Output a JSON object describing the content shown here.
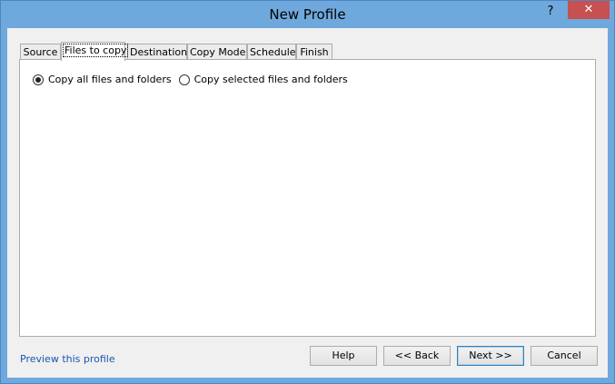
{
  "window": {
    "title": "New Profile",
    "help_glyph": "?",
    "close_glyph": "✕"
  },
  "tabs": [
    {
      "label": "Source"
    },
    {
      "label": "Files to copy"
    },
    {
      "label": "Destination"
    },
    {
      "label": "Copy Mode"
    },
    {
      "label": "Schedule"
    },
    {
      "label": "Finish"
    }
  ],
  "active_tab": "Files to copy",
  "files_to_copy": {
    "options": [
      {
        "label": "Copy all files and folders",
        "selected": true
      },
      {
        "label": "Copy selected files and folders",
        "selected": false
      }
    ]
  },
  "footer": {
    "preview_link": "Preview this profile",
    "help": "Help",
    "back": "<< Back",
    "next": "Next >>",
    "cancel": "Cancel"
  }
}
